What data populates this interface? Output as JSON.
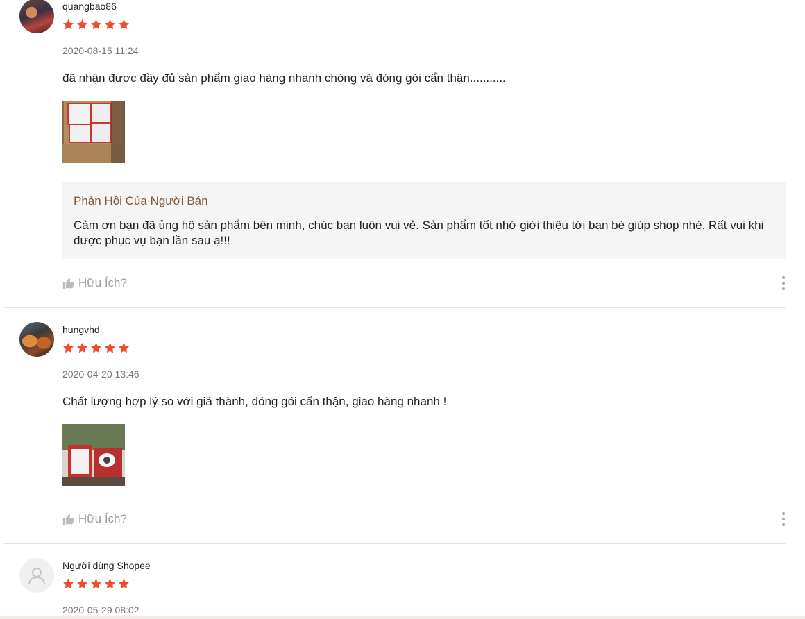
{
  "theme": {
    "star_color": "#ee4d2d",
    "reply_bg": "#f5f5f5",
    "reply_title_color": "#805633"
  },
  "reviews": [
    {
      "username": "quangbao86",
      "rating": 5,
      "timestamp": "2020-08-15 11:24",
      "comment": "đã nhận được đầy đủ sản phẩm giao hàng nhanh chóng và đóng gói cẩn thận...........",
      "seller_reply": {
        "title": "Phản Hồi Của Người Bán",
        "text": "Cảm ơn bạn đã ủng hộ sản phẩm bên minh, chúc bạn luôn vui vẻ. Sản phẩm tốt nhớ giới thiệu tới bạn bè giúp shop nhé. Rất vui khi được phục vụ bạn lần sau ạ!!!"
      },
      "helpful_label": "Hữu Ích?"
    },
    {
      "username": "hungvhd",
      "rating": 5,
      "timestamp": "2020-04-20 13:46",
      "comment": "Chất lượng hợp lý so với giá thành, đóng gói cẩn thận, giao hàng nhanh !",
      "helpful_label": "Hữu Ích?"
    },
    {
      "username": "Người dùng Shopee",
      "rating": 5,
      "timestamp": "2020-05-29 08:02"
    }
  ],
  "icons": {
    "star": "star-icon",
    "thumb": "thumbs-up-icon",
    "more": "more-vertical-icon",
    "default_avatar": "user-icon"
  }
}
